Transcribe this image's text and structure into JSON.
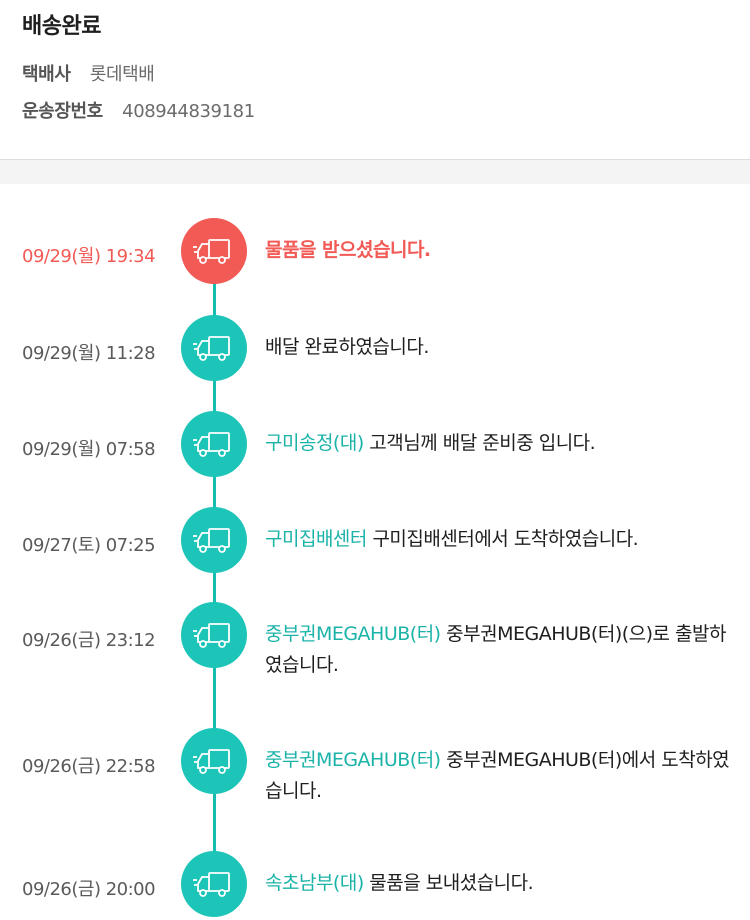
{
  "header": {
    "status": "배송완료",
    "carrier_label": "택배사",
    "carrier_value": "롯데택배",
    "invoice_label": "운송장번호",
    "invoice_value": "408944839181"
  },
  "colors": {
    "accent": "#1cc5b8",
    "current": "#f25a55",
    "location_text": "#1bb3a8"
  },
  "events": [
    {
      "time": "09/29(월) 19:34",
      "location": "",
      "text": "물품을 받으셨습니다.",
      "icon": "truck-icon",
      "current": true
    },
    {
      "time": "09/29(월) 11:28",
      "location": "",
      "text": "배달 완료하였습니다.",
      "icon": "truck-icon"
    },
    {
      "time": "09/29(월) 07:58",
      "location": "구미송정(대)",
      "text": "고객님께 배달 준비중 입니다.",
      "icon": "truck-icon"
    },
    {
      "time": "09/27(토) 07:25",
      "location": "구미집배센터",
      "text": "구미집배센터에서 도착하였습니다.",
      "icon": "truck-icon"
    },
    {
      "time": "09/26(금) 23:12",
      "location": "중부권MEGAHUB(터)",
      "text": "중부권MEGAHUB(터)(으)로 출발하였습니다.",
      "icon": "truck-icon"
    },
    {
      "time": "09/26(금) 22:58",
      "location": "중부권MEGAHUB(터)",
      "text": "중부권MEGAHUB(터)에서 도착하였습니다.",
      "icon": "truck-icon"
    },
    {
      "time": "09/26(금) 20:00",
      "location": "속초남부(대)",
      "text": "물품을 보내셨습니다.",
      "icon": "truck-icon"
    }
  ]
}
